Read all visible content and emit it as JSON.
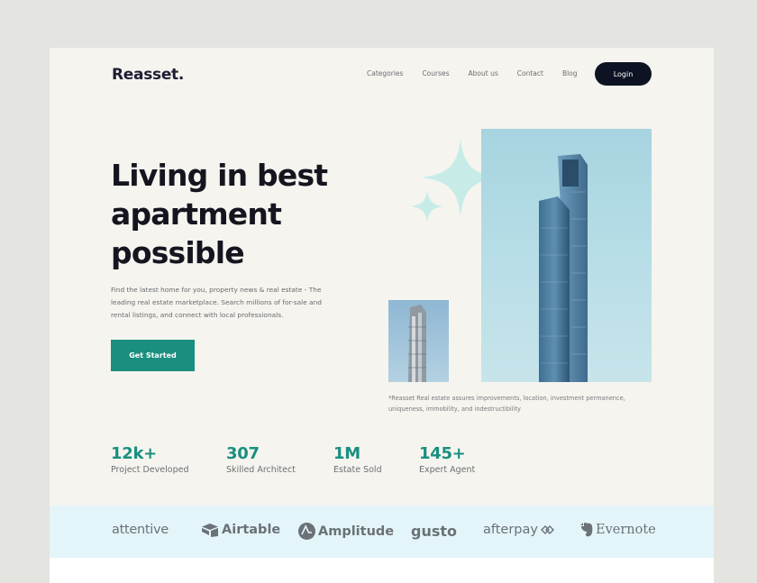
{
  "header": {
    "logo": "Reasset.",
    "nav": [
      "Categories",
      "Courses",
      "About us",
      "Contact",
      "Blog"
    ],
    "login_label": "Login"
  },
  "hero": {
    "title_lines": [
      "Living in best",
      "apartment",
      "possible"
    ],
    "description_lines": [
      "Find the latest home for you, property news & real estate - The",
      "leading real estate marketplace. Search millions of for-sale and",
      "rental listings,  and connect with local professionals."
    ],
    "cta_label": "Get Started",
    "photo_caption_lines": [
      "*Reasset Real estate assures improvements, location, investment permanence,",
      "uniqueness, immobility, and indestructibility"
    ]
  },
  "stats": [
    {
      "value": "12k+",
      "label": "Project Developed"
    },
    {
      "value": "307",
      "label": "Skilled Architect"
    },
    {
      "value": "1M",
      "label": "Estate Sold"
    },
    {
      "value": "145+",
      "label": "Expert Agent"
    }
  ],
  "brands": [
    "attentive",
    "Airtable",
    "Amplitude",
    "gusto",
    "afterpay",
    "Evernote"
  ],
  "colors": {
    "accent": "#1a8f7f",
    "dark": "#0e1323",
    "background": "#f5f4ef",
    "brand_strip": "#e4f5f9",
    "sparkle": "#c7ece8"
  }
}
